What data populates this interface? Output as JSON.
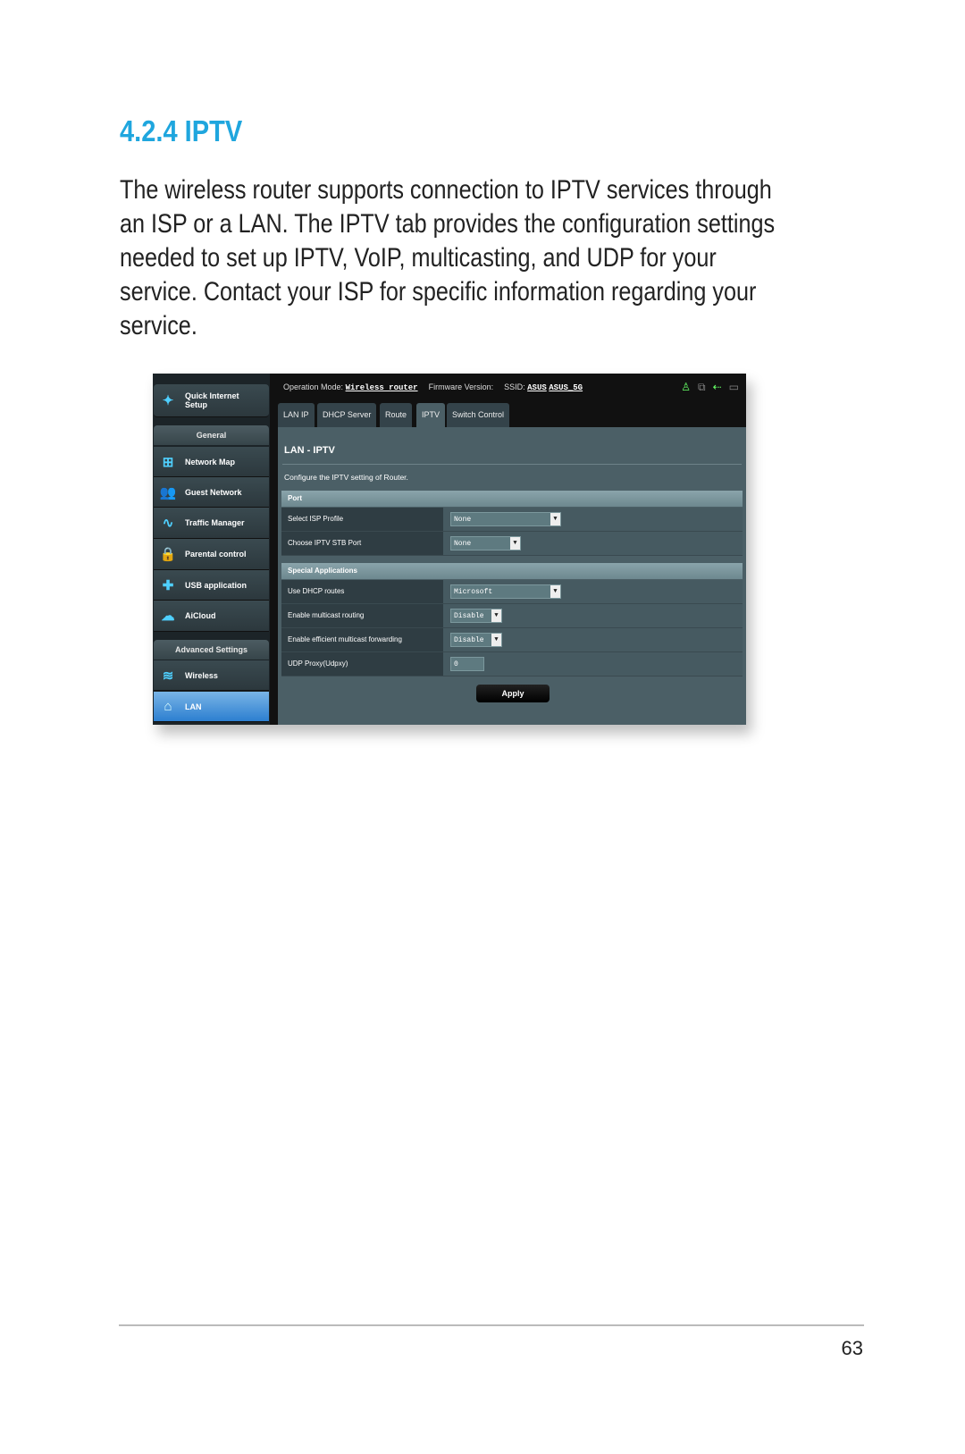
{
  "heading": "4.2.4 IPTV",
  "paragraph_lines": [
    "The wireless router supports connection to IPTV services through",
    "an ISP or a LAN. The IPTV tab provides the configuration settings",
    "needed to set up IPTV, VoIP, multicasting, and UDP for your",
    "service. Contact your ISP for specific information regarding your",
    "service."
  ],
  "router": {
    "quick_setup": "Quick Internet Setup",
    "general": "General",
    "general_items": [
      {
        "label": "Network Map",
        "icon": "network-map-icon"
      },
      {
        "label": "Guest Network",
        "icon": "guest-network-icon"
      },
      {
        "label": "Traffic Manager",
        "icon": "traffic-manager-icon"
      },
      {
        "label": "Parental control",
        "icon": "lock-icon"
      },
      {
        "label": "USB application",
        "icon": "puzzle-icon"
      },
      {
        "label": "AiCloud",
        "icon": "cloud-icon"
      }
    ],
    "advanced": "Advanced Settings",
    "advanced_items": [
      {
        "label": "Wireless",
        "icon": "wifi-icon"
      },
      {
        "label": "LAN",
        "icon": "home-icon",
        "active": true
      }
    ],
    "op_mode_label": "Operation Mode:",
    "op_mode": "Wireless router",
    "fw_label": "Firmware Version:",
    "ssid_label": "SSID:",
    "ssid1": "ASUS",
    "ssid2": "ASUS_5G",
    "tabs": [
      "LAN IP",
      "DHCP Server",
      "Route",
      "IPTV",
      "Switch Control"
    ],
    "active_tab": "IPTV",
    "title": "LAN - IPTV",
    "description": "Configure the IPTV setting of Router.",
    "port_section": "Port",
    "port_rows": [
      {
        "label": "Select ISP Profile",
        "value": "None"
      },
      {
        "label": "Choose IPTV STB Port",
        "value": "None"
      }
    ],
    "special_section": "Special Applications",
    "special_rows": [
      {
        "label": "Use DHCP routes",
        "value": "Microsoft"
      },
      {
        "label": "Enable multicast routing",
        "value": "Disable"
      },
      {
        "label": "Enable efficient multicast forwarding",
        "value": "Disable"
      },
      {
        "label": "UDP Proxy(Udpxy)",
        "value": "0"
      }
    ],
    "apply": "Apply",
    "active_color": "#3b8fd8"
  },
  "page_number": "63"
}
